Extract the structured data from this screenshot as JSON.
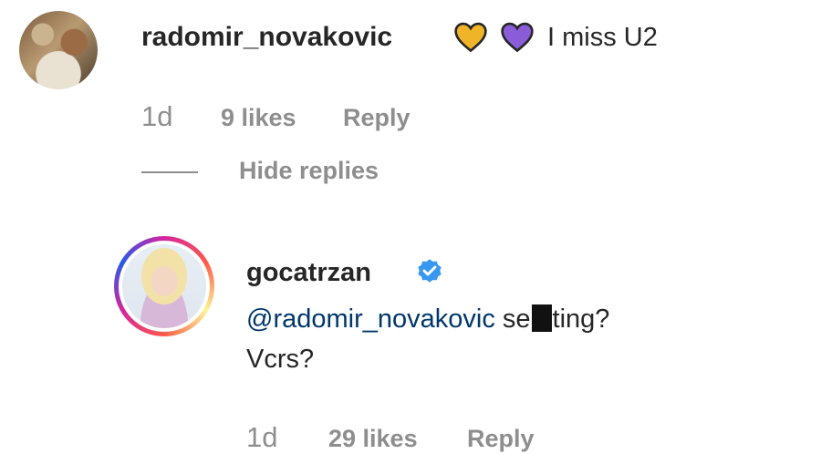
{
  "comment": {
    "username": "radomir_novakovic",
    "text": "I miss U2",
    "hearts": [
      {
        "icon": "yellow-heart-icon",
        "color": "#f0b429"
      },
      {
        "icon": "purple-heart-icon",
        "color": "#8a5cd8"
      }
    ],
    "time": "1d",
    "likes": "9 likes",
    "reply_label": "Reply",
    "hide_replies_label": "Hide replies"
  },
  "reply": {
    "username": "gocatrzan",
    "verified": true,
    "mention": "@radomir_novakovic",
    "text_before_redaction": " se",
    "text_after_redaction": "ting?",
    "second_line": "Vcrs?",
    "time": "1d",
    "likes": "29 likes",
    "reply_label": "Reply"
  },
  "colors": {
    "text": "#262626",
    "muted": "#8e8e8e",
    "mention": "#00376b",
    "verified": "#3897f0"
  }
}
